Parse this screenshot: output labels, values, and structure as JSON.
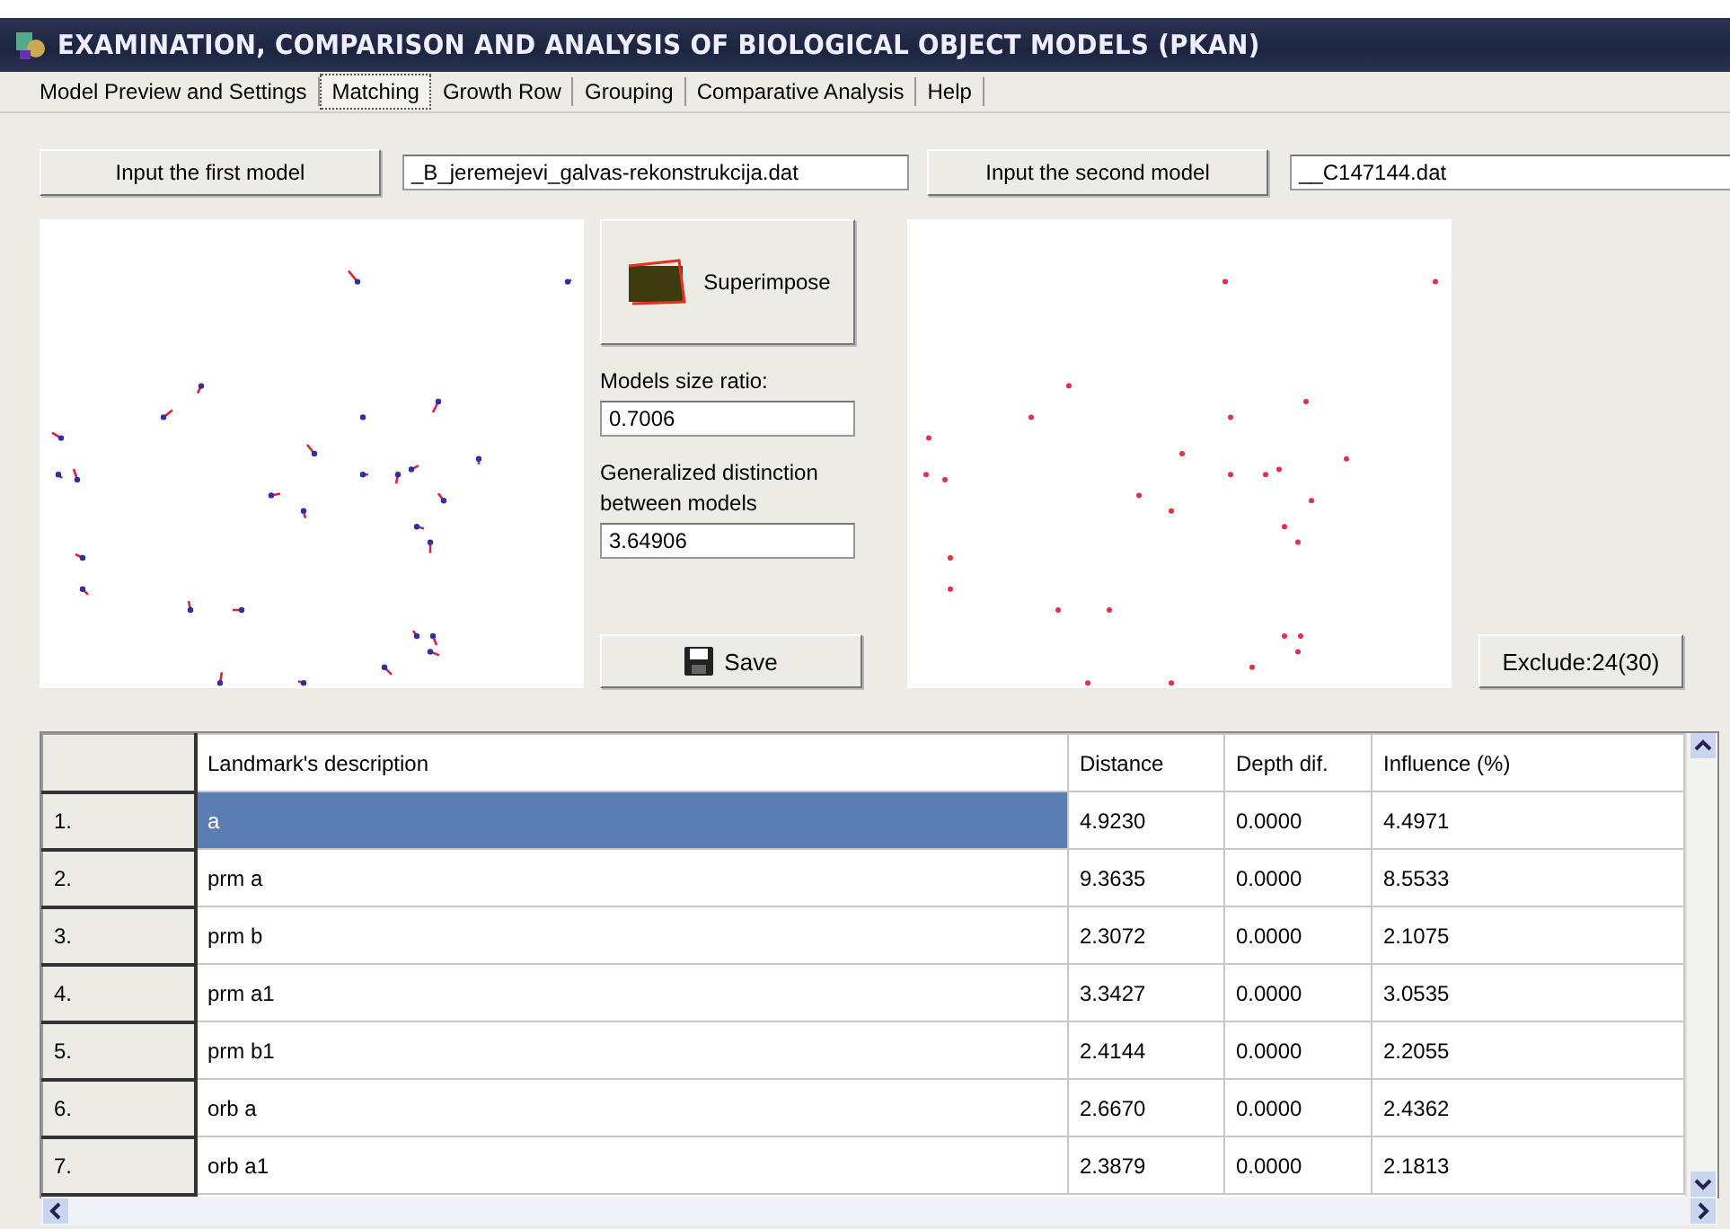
{
  "window": {
    "title": "EXAMINATION, COMPARISON AND ANALYSIS OF BIOLOGICAL OBJECT MODELS (PKAN)"
  },
  "tabs": [
    {
      "label": "Model Preview and Settings",
      "selected": false
    },
    {
      "label": "Matching",
      "selected": true
    },
    {
      "label": "Growth Row",
      "selected": false
    },
    {
      "label": "Grouping",
      "selected": false
    },
    {
      "label": "Comparative Analysis",
      "selected": false
    },
    {
      "label": "Help",
      "selected": false
    }
  ],
  "first_model": {
    "button": "Input the first model",
    "file": "_B_jeremejevi_galvas-rekonstrukcija.dat"
  },
  "second_model": {
    "button": "Input the second model",
    "file": "__C147144.dat"
  },
  "superimpose_button": "Superimpose",
  "size_ratio": {
    "label": "Models size ratio:",
    "value": "0.7006"
  },
  "distinction": {
    "label": "Generalized distinction between models",
    "value": "3.64906"
  },
  "save_button": "Save",
  "exclude_button": "Exclude:24(30)",
  "table": {
    "columns": [
      "Landmark's description",
      "Distance",
      "Depth dif.",
      "Influence (%)"
    ],
    "rows": [
      {
        "index": "1.",
        "cells": [
          "a",
          "4.9230",
          "0.0000",
          "4.4971"
        ],
        "selected": true
      },
      {
        "index": "2.",
        "cells": [
          "prm a",
          "9.3635",
          "0.0000",
          "8.5533"
        ],
        "selected": false
      },
      {
        "index": "3.",
        "cells": [
          "prm b",
          "2.3072",
          "0.0000",
          "2.1075"
        ],
        "selected": false
      },
      {
        "index": "4.",
        "cells": [
          "prm a1",
          "3.3427",
          "0.0000",
          "3.0535"
        ],
        "selected": false
      },
      {
        "index": "5.",
        "cells": [
          "prm b1",
          "2.4144",
          "0.0000",
          "2.2055"
        ],
        "selected": false
      },
      {
        "index": "6.",
        "cells": [
          "orb a",
          "2.6670",
          "0.0000",
          "2.4362"
        ],
        "selected": false
      },
      {
        "index": "7.",
        "cells": [
          "orb a1",
          "2.3879",
          "0.0000",
          "2.1813"
        ],
        "selected": false
      }
    ]
  }
}
